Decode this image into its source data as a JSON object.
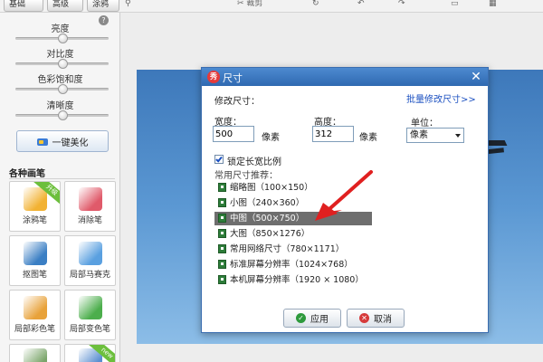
{
  "top_toolbar": {
    "tabs": [
      "基础",
      "高级",
      "涂鸦"
    ],
    "crop_label": "裁剪",
    "truncated_items": [
      "裁剪",
      "旋转",
      "撤销",
      "重做",
      "对比",
      "原图"
    ]
  },
  "left_panel": {
    "sliders": [
      {
        "label": "亮度",
        "value": 0.5
      },
      {
        "label": "对比度",
        "value": 0.5
      },
      {
        "label": "色彩饱和度",
        "value": 0.5
      },
      {
        "label": "清晰度",
        "value": 0.5
      }
    ],
    "beautify_button": "一键美化",
    "brushes_title": "各种画笔",
    "brushes": [
      {
        "label": "涂鸦笔",
        "badge": "升级",
        "icon": "pencil-icon",
        "color": "#f2b233"
      },
      {
        "label": "消除笔",
        "badge": "",
        "icon": "eraser-icon",
        "color": "#e05a6a"
      },
      {
        "label": "抠图笔",
        "badge": "",
        "icon": "cutout-pen-icon",
        "color": "#3b7fc4"
      },
      {
        "label": "局部马赛克",
        "badge": "",
        "icon": "mosaic-icon",
        "color": "#5aa0e0"
      },
      {
        "label": "局部彩色笔",
        "badge": "",
        "icon": "color-pen-icon",
        "color": "#e8a23a"
      },
      {
        "label": "局部变色笔",
        "badge": "",
        "icon": "recolor-pen-icon",
        "color": "#4cae4c"
      },
      {
        "label": "",
        "badge": "",
        "icon": "brush-icon",
        "color": "#7aa56a"
      },
      {
        "label": "",
        "badge": "new",
        "icon": "magic-brush-icon",
        "color": "#5b8fd0"
      }
    ]
  },
  "dialog": {
    "title": "尺寸",
    "logo_text": "秀",
    "close_glyph": "✕",
    "section_label": "修改尺寸：",
    "batch_link": "批量修改尺寸>>",
    "width_label": "宽度：",
    "width_value": "500",
    "width_unit": "像素",
    "height_label": "高度：",
    "height_value": "312",
    "height_unit": "像素",
    "unit_label": "单位：",
    "unit_value": "像素",
    "lock_ratio_label": "锁定长宽比例",
    "lock_ratio_checked": true,
    "presets_label": "常用尺寸推荐：",
    "presets": [
      {
        "label": "缩略图（100×150）",
        "selected": false
      },
      {
        "label": "小图（240×360）",
        "selected": false
      },
      {
        "label": "中图（500×750）",
        "selected": true
      },
      {
        "label": "大图（850×1276）",
        "selected": false
      },
      {
        "label": "常用网络尺寸（780×1171）",
        "selected": false
      },
      {
        "label": "标准屏幕分辨率（1024×768）",
        "selected": false
      },
      {
        "label": "本机屏幕分辨率（1920 × 1080）",
        "selected": false
      }
    ],
    "apply_button": "应用",
    "cancel_button": "取消"
  },
  "colors": {
    "dialog_title_bar": "#2f69b1",
    "selected_row": "#6e6e6e",
    "link": "#1a4fc0",
    "annotation_arrow": "#e02020"
  }
}
